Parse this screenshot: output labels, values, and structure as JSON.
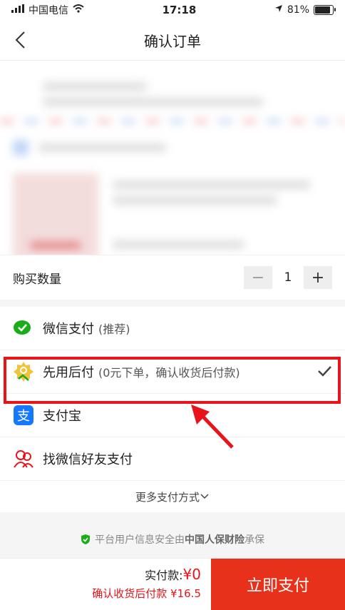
{
  "status": {
    "carrier": "中国电信",
    "time": "17:18",
    "battery": "81%"
  },
  "nav": {
    "title": "确认订单"
  },
  "quantity": {
    "label": "购买数量",
    "minus": "−",
    "value": "1",
    "plus": "+"
  },
  "payment": {
    "options": [
      {
        "name": "微信支付",
        "note": "(推荐)"
      },
      {
        "name": "先用后付",
        "note": "(0元下单，确认收货后付款)"
      },
      {
        "name": "支付宝",
        "note": ""
      },
      {
        "name": "找微信好友支付",
        "note": ""
      }
    ],
    "more": "更多支付方式"
  },
  "assurance": {
    "prefix": "平台用户信息安全由",
    "company": "中国人保财险",
    "suffix": "承保"
  },
  "footer": {
    "paid_label": "实付款:",
    "paid_amount": "¥0",
    "later_text": "确认收货后付款 ¥16.5",
    "pay_button": "立即支付"
  },
  "colors": {
    "accent": "#e8141a",
    "wechat": "#1aad19",
    "alipay": "#1677ff"
  }
}
